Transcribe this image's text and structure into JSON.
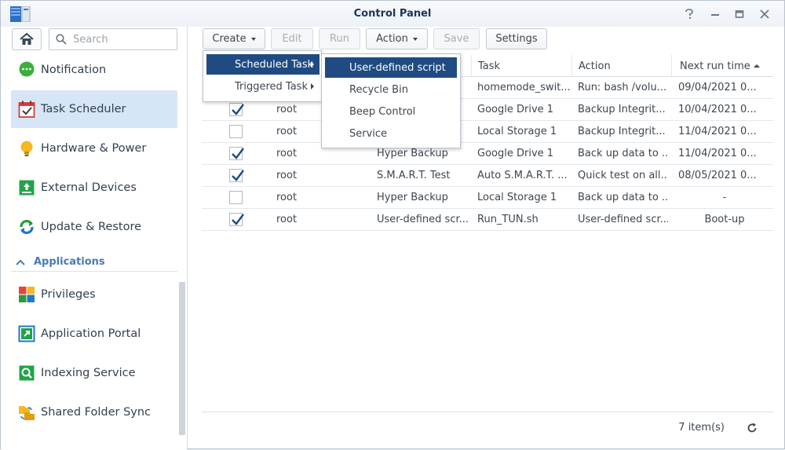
{
  "window": {
    "title": "Control Panel"
  },
  "sidebar": {
    "search_placeholder": "Search",
    "items": [
      {
        "label": "Notification"
      },
      {
        "label": "Task Scheduler"
      },
      {
        "label": "Hardware & Power"
      },
      {
        "label": "External Devices"
      },
      {
        "label": "Update & Restore"
      }
    ],
    "section": "Applications",
    "app_items": [
      {
        "label": "Privileges"
      },
      {
        "label": "Application Portal"
      },
      {
        "label": "Indexing Service"
      },
      {
        "label": "Shared Folder Sync"
      }
    ]
  },
  "toolbar": {
    "create": "Create",
    "edit": "Edit",
    "run": "Run",
    "action": "Action",
    "save": "Save",
    "settings": "Settings"
  },
  "table": {
    "headers": {
      "task": "Task",
      "action": "Action",
      "next_run": "Next run time"
    },
    "rows": [
      {
        "checked": false,
        "owner": "",
        "type": "",
        "task": "homemode_swit...",
        "action": "Run: bash /volu...",
        "next": "09/04/2021 0..."
      },
      {
        "checked": true,
        "owner": "root",
        "type": "",
        "task": "Google Drive 1",
        "action": "Backup Integrit...",
        "next": "10/04/2021 0..."
      },
      {
        "checked": false,
        "owner": "root",
        "type": "",
        "task": "Local Storage 1",
        "action": "Backup Integrit...",
        "next": "11/04/2021 0..."
      },
      {
        "checked": true,
        "owner": "root",
        "type": "Hyper Backup",
        "task": "Google Drive 1",
        "action": "Back up data to ...",
        "next": "11/04/2021 0..."
      },
      {
        "checked": true,
        "owner": "root",
        "type": "S.M.A.R.T. Test",
        "task": "Auto S.M.A.R.T. ...",
        "action": "Quick test on all...",
        "next": "08/05/2021 0..."
      },
      {
        "checked": false,
        "owner": "root",
        "type": "Hyper Backup",
        "task": "Local Storage 1",
        "action": "Back up data to ...",
        "next": "-"
      },
      {
        "checked": true,
        "owner": "root",
        "type": "User-defined scr...",
        "task": "Run_TUN.sh",
        "action": "User-defined scr...",
        "next": "Boot-up"
      }
    ]
  },
  "footer": {
    "count": "7 item(s)"
  },
  "create_menu": {
    "items": [
      "Scheduled Task",
      "Triggered Task"
    ],
    "submenu": [
      "User-defined script",
      "Recycle Bin",
      "Beep Control",
      "Service"
    ]
  },
  "colors": {
    "accent": "#1f4b82",
    "active_nav": "#d6e6f6",
    "section": "#4a7ab5"
  }
}
